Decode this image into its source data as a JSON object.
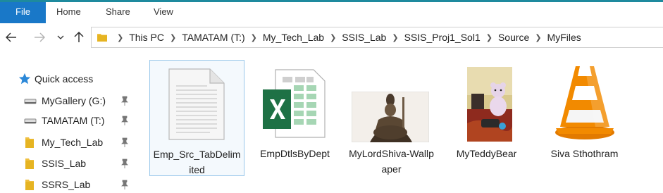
{
  "ribbon": {
    "tabs": [
      "File",
      "Home",
      "Share",
      "View"
    ]
  },
  "nav": {
    "back_icon": "arrow-left-icon",
    "forward_icon": "arrow-right-icon",
    "recent_icon": "chevron-down-icon",
    "up_icon": "arrow-up-icon"
  },
  "address": {
    "crumbs": [
      "This PC",
      "TAMATAM (T:)",
      "My_Tech_Lab",
      "SSIS_Lab",
      "SSIS_Proj1_Sol1",
      "Source",
      "MyFiles"
    ]
  },
  "sidebar": {
    "quick_access": "Quick access",
    "items": [
      {
        "label": "MyGallery (G:)",
        "icon": "drive-icon"
      },
      {
        "label": "TAMATAM (T:)",
        "icon": "drive-icon"
      },
      {
        "label": "My_Tech_Lab",
        "icon": "folder-icon"
      },
      {
        "label": "SSIS_Lab",
        "icon": "folder-icon"
      },
      {
        "label": "SSRS_Lab",
        "icon": "folder-icon"
      }
    ]
  },
  "files": [
    {
      "name": "Emp_Src_TabDelimited",
      "type": "text-document-icon",
      "selected": true
    },
    {
      "name": "EmpDtlsByDept",
      "type": "excel-file-icon"
    },
    {
      "name": "MyLordShiva-Wallpaper",
      "type": "image-thumbnail"
    },
    {
      "name": "MyTeddyBear",
      "type": "image-thumbnail"
    },
    {
      "name": "Siva Sthothram",
      "type": "vlc-media-icon"
    }
  ],
  "colors": {
    "file_tab": "#1978c8",
    "ribbon_accent": "#1e8a9e",
    "selection_border": "#99c7ea",
    "folder": "#f0c040",
    "excel_green": "#1e7145",
    "vlc_orange": "#f28a00"
  }
}
